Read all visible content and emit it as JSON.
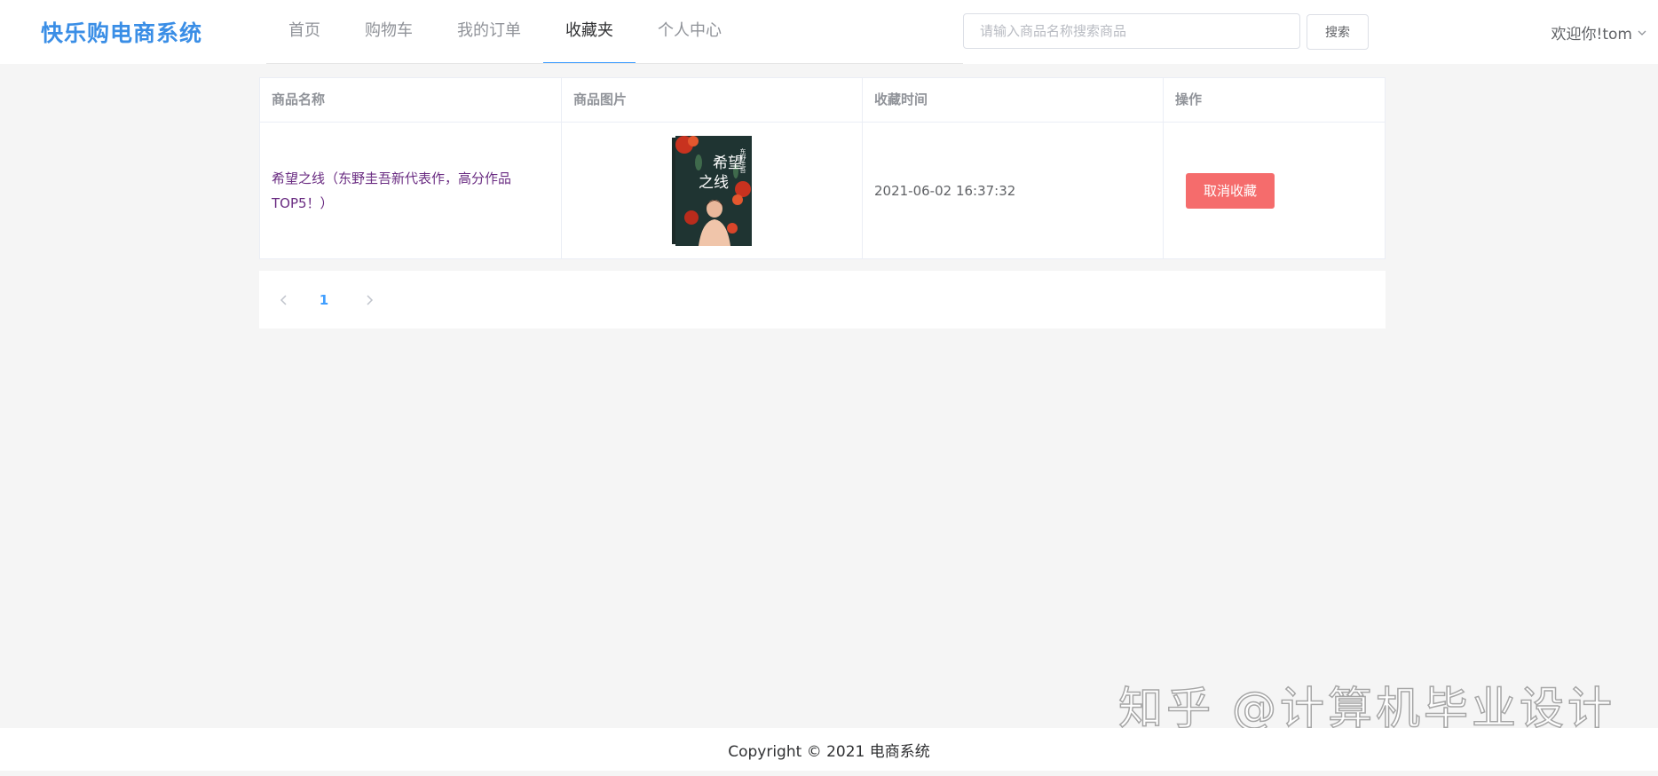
{
  "header": {
    "logo": "快乐购电商系统",
    "nav": [
      {
        "label": "首页"
      },
      {
        "label": "购物车"
      },
      {
        "label": "我的订单"
      },
      {
        "label": "收藏夹"
      },
      {
        "label": "个人中心"
      }
    ],
    "active_nav": "收藏夹",
    "search": {
      "placeholder": "请输入商品名称搜索商品",
      "value": "",
      "button_label": "搜索"
    },
    "user": {
      "greeting": "欢迎你!tom"
    }
  },
  "table": {
    "columns": [
      "商品名称",
      "商品图片",
      "收藏时间",
      "操作"
    ],
    "rows": [
      {
        "name": "希望之线（东野圭吾新代表作，高分作品TOP5！）",
        "image_alt": "希望之线",
        "cover_author": "东野圭吾",
        "favorited_at": "2021-06-02 16:37:32",
        "action_label": "取消收藏"
      }
    ]
  },
  "pagination": {
    "current_page": "1"
  },
  "footer": {
    "copyright": "Copyright © 2021 电商系统"
  },
  "watermark": "知乎 @计算机毕业设计",
  "colors": {
    "brand": "#3a8ee6",
    "active_underline": "#409eff",
    "danger": "#f56c6c",
    "product_link": "#6a2c82"
  },
  "icons": {
    "user_dropdown": "chevron-down-icon",
    "prev_page": "chevron-left-icon",
    "next_page": "chevron-right-icon"
  }
}
